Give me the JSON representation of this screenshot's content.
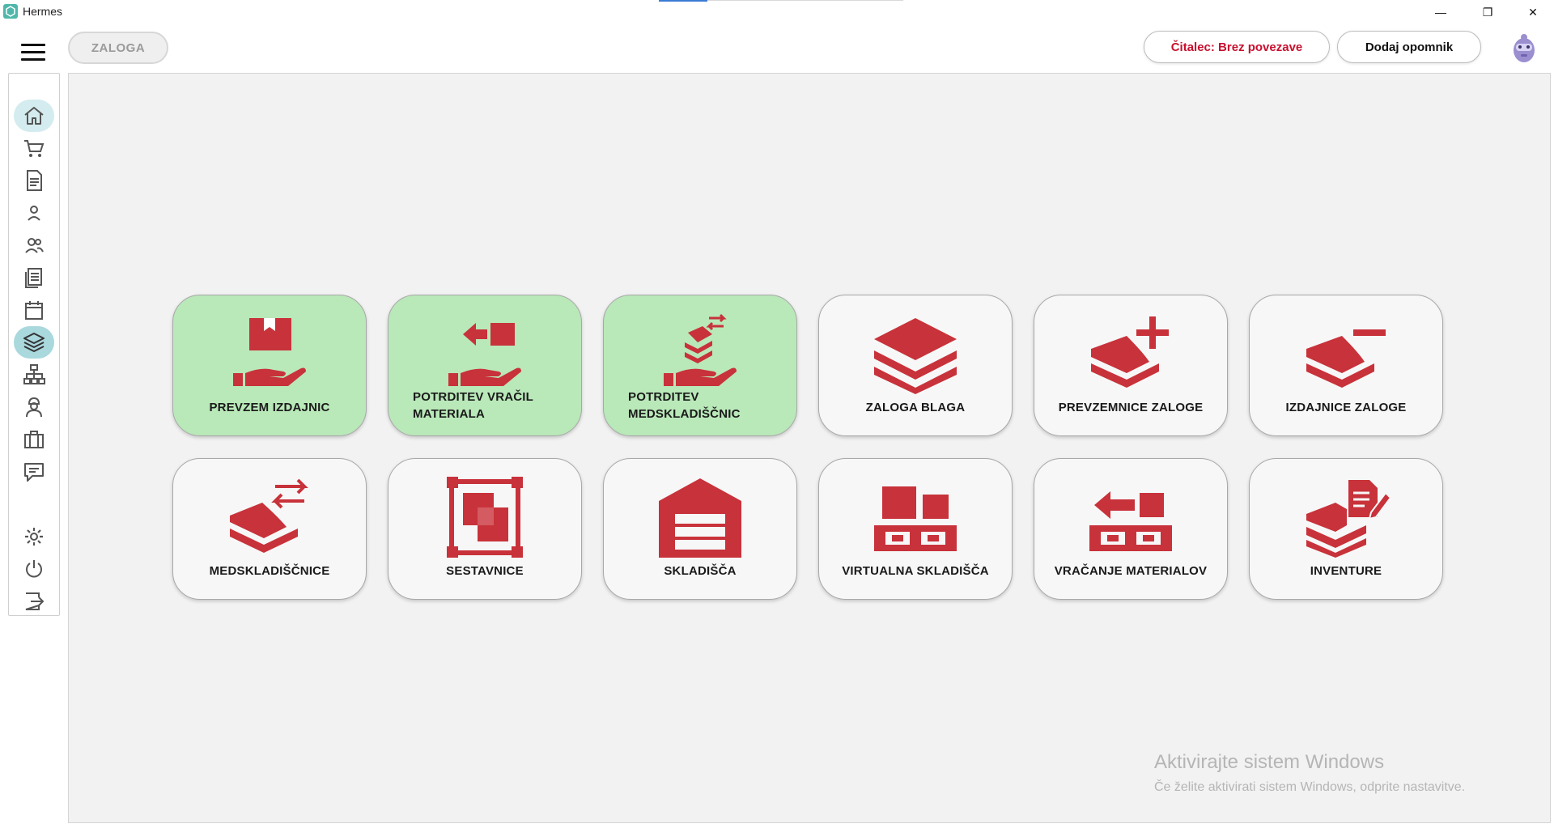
{
  "window": {
    "title": "Hermes",
    "minimize_glyph": "—",
    "restore_glyph": "❐",
    "close_glyph": "✕"
  },
  "toolbar": {
    "breadcrumb": "ZALOGA",
    "reader_status": "Čitalec: Brez povezave",
    "add_reminder": "Dodaj opomnik"
  },
  "sidebar": {
    "items": [
      {
        "name": "home-icon",
        "active": true
      },
      {
        "name": "cart-icon"
      },
      {
        "name": "document-icon"
      },
      {
        "name": "user-icon"
      },
      {
        "name": "users-icon"
      },
      {
        "name": "list-icon"
      },
      {
        "name": "calendar-icon"
      },
      {
        "name": "layers-icon",
        "active": true
      },
      {
        "name": "hierarchy-icon"
      },
      {
        "name": "worker-icon"
      },
      {
        "name": "briefcase-icon"
      },
      {
        "name": "chat-icon"
      },
      {
        "name": "settings-icon"
      },
      {
        "name": "power-icon"
      },
      {
        "name": "logout-icon"
      }
    ]
  },
  "tiles": [
    {
      "label": "PREVZEM IZDAJNIC",
      "icon": "box-hand-icon",
      "green": true
    },
    {
      "label": "POTRDITEV VRAČIL MATERIALA",
      "icon": "return-hand-icon",
      "green": true
    },
    {
      "label": "POTRDITEV MEDSKLADIŠČNIC",
      "icon": "transfer-hand-icon",
      "green": true
    },
    {
      "label": "ZALOGA BLAGA",
      "icon": "stack-icon",
      "green": false
    },
    {
      "label": "PREVZEMNICE ZALOGE",
      "icon": "stack-plus-icon",
      "green": false
    },
    {
      "label": "IZDAJNICE ZALOGE",
      "icon": "stack-minus-icon",
      "green": false
    },
    {
      "label": "MEDSKLADIŠČNICE",
      "icon": "stack-transfer-icon",
      "green": false
    },
    {
      "label": "SESTAVNICE",
      "icon": "assembly-icon",
      "green": false
    },
    {
      "label": "SKLADIŠČA",
      "icon": "warehouse-icon",
      "green": false
    },
    {
      "label": "VIRTUALNA SKLADIŠČA",
      "icon": "pallet-icon",
      "green": false
    },
    {
      "label": "VRAČANJE MATERIALOV",
      "icon": "pallet-return-icon",
      "green": false
    },
    {
      "label": "INVENTURE",
      "icon": "stack-document-icon",
      "green": false
    }
  ],
  "watermark": {
    "title": "Aktivirajte sistem Windows",
    "subtitle": "Če želite aktivirati sistem Windows, odprite nastavitve."
  },
  "colors": {
    "icon_red": "#c8323a",
    "tile_green": "#b9e8b9",
    "tile_default": "#f7f7f7",
    "sidebar_active": "#d4ecef"
  }
}
